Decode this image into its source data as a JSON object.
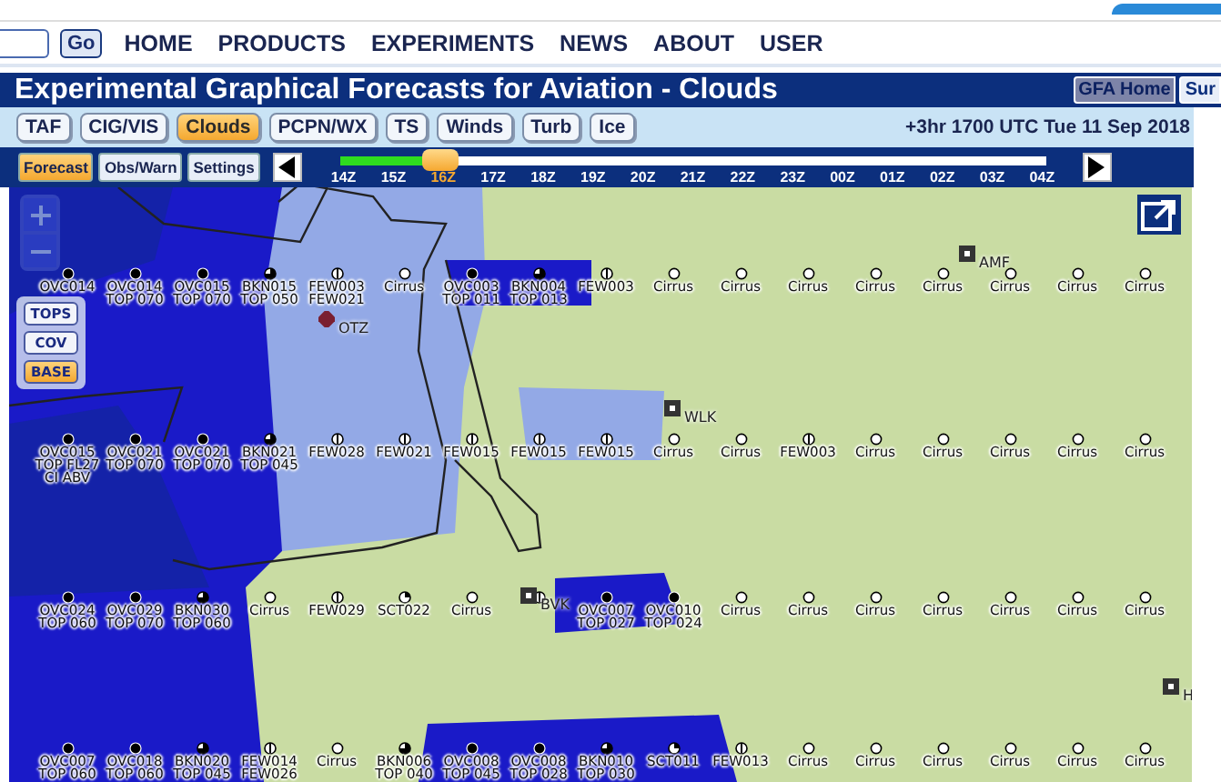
{
  "nav": {
    "go_button": "Go",
    "links": [
      "HOME",
      "PRODUCTS",
      "EXPERIMENTS",
      "NEWS",
      "ABOUT",
      "USER"
    ]
  },
  "title_bar": {
    "title": "Experimental Graphical Forecasts for Aviation - Clouds",
    "buttons": [
      "GFA Home",
      "Sur"
    ]
  },
  "product_tabs": [
    {
      "label": "TAF",
      "selected": false
    },
    {
      "label": "CIG/VIS",
      "selected": false
    },
    {
      "label": "Clouds",
      "selected": true
    },
    {
      "label": "PCPN/WX",
      "selected": false
    },
    {
      "label": "TS",
      "selected": false
    },
    {
      "label": "Winds",
      "selected": false
    },
    {
      "label": "Turb",
      "selected": false
    },
    {
      "label": "Ice",
      "selected": false
    }
  ],
  "valid_time": "+3hr 1700 UTC Tue 11 Sep 2018",
  "mode_tabs": [
    {
      "label": "Forecast",
      "selected": true
    },
    {
      "label": "Obs/Warn",
      "selected": false
    },
    {
      "label": "Settings",
      "selected": false
    }
  ],
  "timeline": {
    "level": 0.143,
    "hours": [
      {
        "label": "14Z",
        "selected": false
      },
      {
        "label": "15Z",
        "selected": false
      },
      {
        "label": "16Z",
        "selected": true
      },
      {
        "label": "17Z",
        "selected": false
      },
      {
        "label": "18Z",
        "selected": false
      },
      {
        "label": "19Z",
        "selected": false
      },
      {
        "label": "20Z",
        "selected": false
      },
      {
        "label": "21Z",
        "selected": false
      },
      {
        "label": "22Z",
        "selected": false
      },
      {
        "label": "23Z",
        "selected": false
      },
      {
        "label": "00Z",
        "selected": false
      },
      {
        "label": "01Z",
        "selected": false
      },
      {
        "label": "02Z",
        "selected": false
      },
      {
        "label": "03Z",
        "selected": false
      },
      {
        "label": "04Z",
        "selected": false
      }
    ]
  },
  "layer_buttons": [
    {
      "label": "TOPS",
      "selected": false
    },
    {
      "label": "COV",
      "selected": false
    },
    {
      "label": "BASE",
      "selected": true
    }
  ],
  "airports": [
    {
      "code": "OTZ",
      "kind": "cross"
    },
    {
      "code": "WLK",
      "kind": "dot"
    },
    {
      "code": "AMF",
      "kind": "dot"
    },
    {
      "code": "BVK",
      "kind": "dot"
    },
    {
      "code": "H",
      "kind": "dot"
    }
  ],
  "station_rows": [
    [
      {
        "kind": "ovc",
        "lines": [
          "OVC014"
        ]
      },
      {
        "kind": "ovc",
        "lines": [
          "OVC014",
          "TOP 070"
        ]
      },
      {
        "kind": "ovc",
        "lines": [
          "OVC015",
          "TOP 070"
        ]
      },
      {
        "kind": "bkn",
        "lines": [
          "BKN015",
          "TOP 050"
        ]
      },
      {
        "kind": "few",
        "lines": [
          "FEW003",
          "FEW021"
        ]
      },
      {
        "kind": "clr",
        "lines": [
          "Cirrus"
        ]
      },
      {
        "kind": "ovc",
        "lines": [
          "OVC003",
          "TOP 011"
        ]
      },
      {
        "kind": "bkn",
        "lines": [
          "BKN004",
          "TOP 013"
        ]
      },
      {
        "kind": "few",
        "lines": [
          "FEW003"
        ]
      },
      {
        "kind": "clr",
        "lines": [
          "Cirrus"
        ]
      },
      {
        "kind": "clr",
        "lines": [
          "Cirrus"
        ]
      },
      {
        "kind": "clr",
        "lines": [
          "Cirrus"
        ]
      },
      {
        "kind": "clr",
        "lines": [
          "Cirrus"
        ]
      },
      {
        "kind": "clr",
        "lines": [
          "Cirrus"
        ]
      },
      {
        "kind": "clr",
        "lines": [
          "Cirrus"
        ]
      },
      {
        "kind": "clr",
        "lines": [
          "Cirrus"
        ]
      },
      {
        "kind": "clr",
        "lines": [
          "Cirrus"
        ]
      }
    ],
    [
      {
        "kind": "ovc",
        "lines": [
          "OVC015",
          "TOP FL27",
          "CI ABV"
        ]
      },
      {
        "kind": "ovc",
        "lines": [
          "OVC021",
          "TOP 070"
        ]
      },
      {
        "kind": "ovc",
        "lines": [
          "OVC021",
          "TOP 070"
        ]
      },
      {
        "kind": "bkn",
        "lines": [
          "BKN021",
          "TOP 045"
        ]
      },
      {
        "kind": "few",
        "lines": [
          "FEW028"
        ]
      },
      {
        "kind": "few",
        "lines": [
          "FEW021"
        ]
      },
      {
        "kind": "few",
        "lines": [
          "FEW015"
        ]
      },
      {
        "kind": "few",
        "lines": [
          "FEW015"
        ]
      },
      {
        "kind": "few",
        "lines": [
          "FEW015"
        ]
      },
      {
        "kind": "clr",
        "lines": [
          "Cirrus"
        ]
      },
      {
        "kind": "clr",
        "lines": [
          "Cirrus"
        ]
      },
      {
        "kind": "few",
        "lines": [
          "FEW003"
        ]
      },
      {
        "kind": "clr",
        "lines": [
          "Cirrus"
        ]
      },
      {
        "kind": "clr",
        "lines": [
          "Cirrus"
        ]
      },
      {
        "kind": "clr",
        "lines": [
          "Cirrus"
        ]
      },
      {
        "kind": "clr",
        "lines": [
          "Cirrus"
        ]
      },
      {
        "kind": "clr",
        "lines": [
          "Cirrus"
        ]
      }
    ],
    [
      {
        "kind": "ovc",
        "lines": [
          "OVC024",
          "TOP 060"
        ]
      },
      {
        "kind": "ovc",
        "lines": [
          "OVC029",
          "TOP 070"
        ]
      },
      {
        "kind": "bkn",
        "lines": [
          "BKN030",
          "TOP 060"
        ]
      },
      {
        "kind": "clr",
        "lines": [
          "Cirrus"
        ]
      },
      {
        "kind": "few",
        "lines": [
          "FEW029"
        ]
      },
      {
        "kind": "sct",
        "lines": [
          "SCT022"
        ]
      },
      {
        "kind": "clr",
        "lines": [
          "Cirrus"
        ]
      },
      {
        "kind": "few"
      },
      {
        "kind": "ovc",
        "lines": [
          "OVC007",
          "TOP 027"
        ]
      },
      {
        "kind": "ovc",
        "lines": [
          "OVC010",
          "TOP 024"
        ]
      },
      {
        "kind": "clr",
        "lines": [
          "Cirrus"
        ]
      },
      {
        "kind": "clr",
        "lines": [
          "Cirrus"
        ]
      },
      {
        "kind": "clr",
        "lines": [
          "Cirrus"
        ]
      },
      {
        "kind": "clr",
        "lines": [
          "Cirrus"
        ]
      },
      {
        "kind": "clr",
        "lines": [
          "Cirrus"
        ]
      },
      {
        "kind": "clr",
        "lines": [
          "Cirrus"
        ]
      },
      {
        "kind": "clr",
        "lines": [
          "Cirrus"
        ]
      }
    ],
    [
      {
        "kind": "ovc",
        "lines": [
          "OVC007",
          "TOP 060"
        ]
      },
      {
        "kind": "ovc",
        "lines": [
          "OVC018",
          "TOP 060"
        ]
      },
      {
        "kind": "bkn",
        "lines": [
          "BKN020",
          "TOP 045"
        ]
      },
      {
        "kind": "few",
        "lines": [
          "FEW014",
          "FEW026"
        ]
      },
      {
        "kind": "clr",
        "lines": [
          "Cirrus"
        ]
      },
      {
        "kind": "bkn",
        "lines": [
          "BKN006",
          "TOP 040"
        ]
      },
      {
        "kind": "ovc",
        "lines": [
          "OVC008",
          "TOP 045"
        ]
      },
      {
        "kind": "ovc",
        "lines": [
          "OVC008",
          "TOP 028"
        ]
      },
      {
        "kind": "bkn",
        "lines": [
          "BKN010",
          "TOP 030"
        ]
      },
      {
        "kind": "sct",
        "lines": [
          "SCT011"
        ]
      },
      {
        "kind": "few",
        "lines": [
          "FEW013"
        ]
      },
      {
        "kind": "clr",
        "lines": [
          "Cirrus"
        ]
      },
      {
        "kind": "clr",
        "lines": [
          "Cirrus"
        ]
      },
      {
        "kind": "clr",
        "lines": [
          "Cirrus"
        ]
      },
      {
        "kind": "clr",
        "lines": [
          "Cirrus"
        ]
      },
      {
        "kind": "clr",
        "lines": [
          "Cirrus"
        ]
      },
      {
        "kind": "clr",
        "lines": [
          "Cirrus"
        ]
      }
    ]
  ]
}
